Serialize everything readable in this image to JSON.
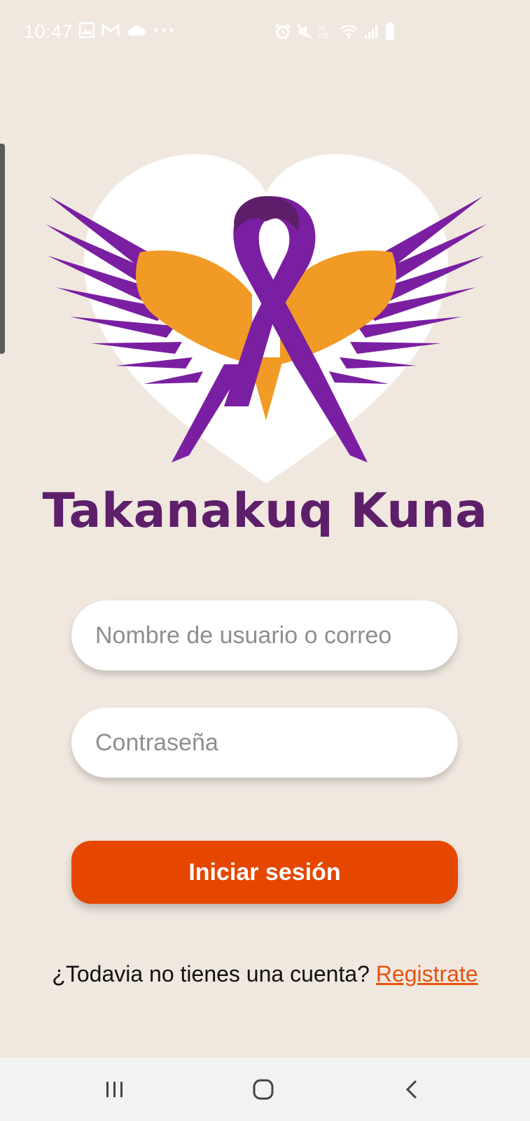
{
  "status_bar": {
    "time": "10:47",
    "left_icons": [
      "image-icon",
      "gmail-icon",
      "cloud-icon",
      "more-dots-icon"
    ],
    "right_icons": [
      "alarm-icon",
      "mute-icon",
      "volte-icon",
      "wifi-icon",
      "signal-icon",
      "battery-icon"
    ]
  },
  "logo": {
    "app_name": "Takanakuq Kuna",
    "colors": {
      "purple": "#7a1fa2",
      "dark_purple": "#5e1f6a",
      "orange": "#f29a26",
      "heart": "#ffffff"
    }
  },
  "login_form": {
    "username_placeholder": "Nombre de usuario o correo",
    "password_placeholder": "Contraseña",
    "submit_label": "Iniciar sesión"
  },
  "signup": {
    "prompt": "¿Todavia no tienes una cuenta?",
    "link_label": "Registrate"
  },
  "nav_bar": {
    "buttons": [
      "recents-icon",
      "home-icon",
      "back-icon"
    ]
  },
  "colors": {
    "background": "#f0e8df",
    "primary_button": "#e54700",
    "link": "#e5530f"
  }
}
